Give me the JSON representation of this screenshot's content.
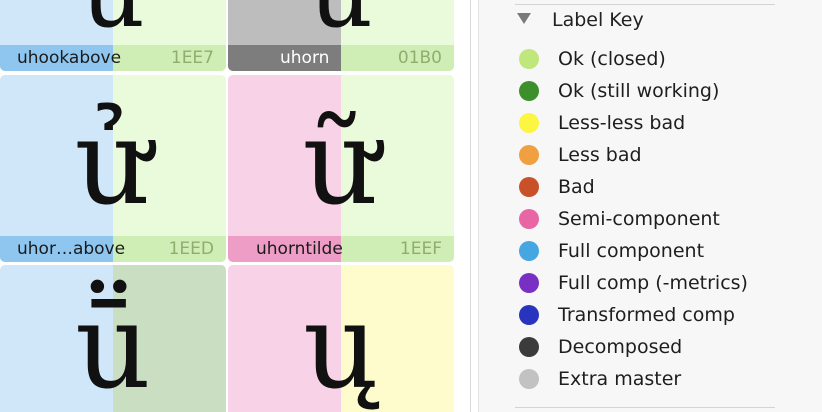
{
  "glyph_cells": [
    {
      "glyph": "u",
      "name": "uhookabove",
      "code": "1EE7",
      "colors": {
        "left_bg": "#cfe7f8",
        "right_bg": "#eafbdc",
        "left_bar": "#8fc6ef",
        "right_bar": "#cfeeb6"
      }
    },
    {
      "glyph": "u",
      "name": "uhorn",
      "code": "01B0",
      "colors": {
        "left_bg": "#bdbdbd",
        "right_bg": "#eafbdc",
        "left_bar": "#7d7d7d",
        "right_bar": "#cfeeb6"
      }
    },
    {
      "glyph": "ử",
      "name": "uhor…above",
      "code": "1EED",
      "colors": {
        "left_bg": "#cfe7f8",
        "right_bg": "#eafbdc",
        "left_bar": "#8fc6ef",
        "right_bar": "#cfeeb6"
      }
    },
    {
      "glyph": "ữ",
      "name": "uhorntilde",
      "code": "1EEF",
      "colors": {
        "left_bg": "#f8d2e6",
        "right_bg": "#eafbdc",
        "left_bar": "#ee9dc6",
        "right_bar": "#cfeeb6"
      }
    },
    {
      "glyph": "ṻ",
      "name": "",
      "code": "",
      "colors": {
        "left_bg": "#cfe7f8",
        "right_bg": "#cadfc2",
        "left_bar": "#cfe7f8",
        "right_bar": "#cadfc2"
      }
    },
    {
      "glyph": "ų",
      "name": "",
      "code": "",
      "colors": {
        "left_bg": "#f8d2e6",
        "right_bg": "#fefccd",
        "left_bar": "#f8d2e6",
        "right_bar": "#fefccd"
      }
    }
  ],
  "label_key": {
    "title": "Label Key",
    "items": [
      {
        "label": "Ok (closed)",
        "color": "#bfe77c"
      },
      {
        "label": "Ok (still working)",
        "color": "#3d8f2c"
      },
      {
        "label": "Less-less bad",
        "color": "#fcf542"
      },
      {
        "label": "Less bad",
        "color": "#f0a040"
      },
      {
        "label": "Bad",
        "color": "#c9512a"
      },
      {
        "label": "Semi-component",
        "color": "#e966a5"
      },
      {
        "label": "Full component",
        "color": "#45a6e2"
      },
      {
        "label": "Full comp (-metrics)",
        "color": "#7a2fc4"
      },
      {
        "label": "Transformed comp",
        "color": "#2934be"
      },
      {
        "label": "Decomposed",
        "color": "#3b3b3b"
      },
      {
        "label": "Extra master",
        "color": "#c2c2c2"
      }
    ]
  }
}
